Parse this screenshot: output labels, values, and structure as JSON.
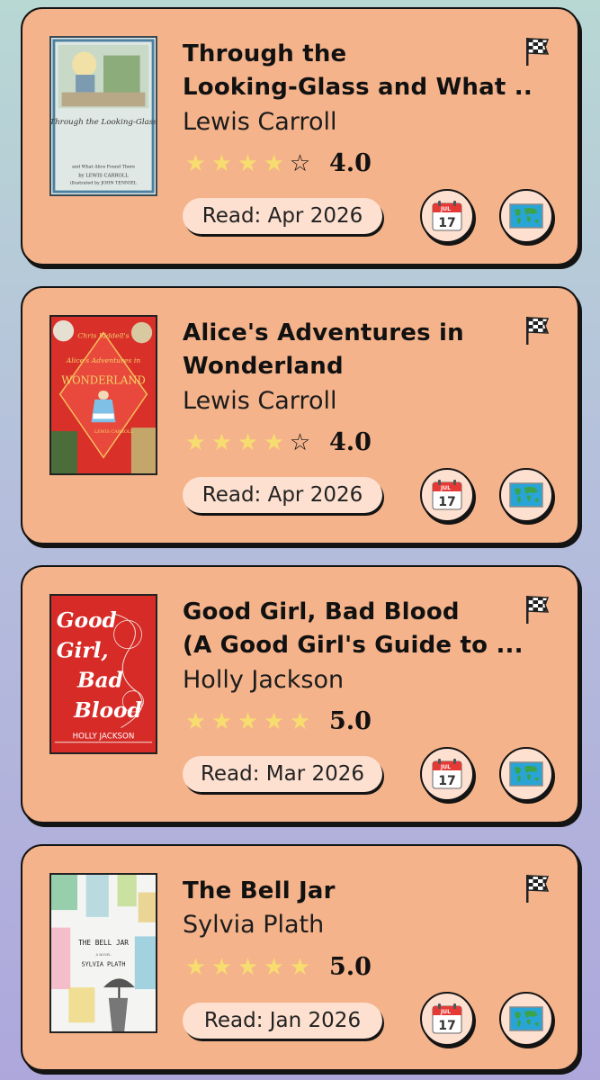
{
  "books": [
    {
      "title_lines": [
        "Through the",
        "Looking-Glass and What ..."
      ],
      "author": "Lewis Carroll",
      "stars": [
        1,
        1,
        1,
        1,
        0
      ],
      "rating": "4.0",
      "read": "Read: Apr 2026",
      "calendar_month": "JUL",
      "calendar_day": "17",
      "cover": {
        "title": "Through the Looking-Glass",
        "text_top": "Through the Looking-Glass",
        "text_bottom": "and What Alice Found There",
        "author": "by LEWIS CARROLL",
        "illustrator": "illustrated by JOHN TENNIEL"
      }
    },
    {
      "title_lines": [
        "Alice's Adventures in",
        "Wonderland"
      ],
      "author": "Lewis Carroll",
      "stars": [
        1,
        1,
        1,
        1,
        0
      ],
      "rating": "4.0",
      "read": "Read: Apr 2026",
      "calendar_month": "JUL",
      "calendar_day": "17",
      "cover": {
        "top": "Chris Riddell's",
        "title": "Alice's Adventures in",
        "title2": "WONDERLAND",
        "author": "LEWIS CARROLL"
      }
    },
    {
      "title_lines": [
        "Good Girl, Bad Blood",
        "(A Good Girl's Guide to ..."
      ],
      "author": "Holly Jackson",
      "stars": [
        1,
        1,
        1,
        1,
        1
      ],
      "rating": "5.0",
      "read": "Read: Mar 2026",
      "calendar_month": "JUL",
      "calendar_day": "17",
      "cover": {
        "w1": "Good",
        "w2": "Girl,",
        "w3": "Bad",
        "w4": "Blood",
        "author": "HOLLY JACKSON"
      }
    },
    {
      "title_lines": [
        "The Bell Jar"
      ],
      "author": "Sylvia Plath",
      "stars": [
        1,
        1,
        1,
        1,
        1
      ],
      "rating": "5.0",
      "read": "Read: Jan 2026",
      "calendar_month": "JUL",
      "calendar_day": "17",
      "cover": {
        "title": "THE BELL JAR",
        "sub": "A NOVEL",
        "author": "SYLVIA PLATH"
      }
    }
  ],
  "icons": {
    "flag": "checkered-flag-icon",
    "calendar": "calendar-icon",
    "map": "world-map-icon"
  },
  "colors": {
    "card": "#f4b38b",
    "pill": "#fde0d0",
    "star": "#f7dc6f"
  }
}
